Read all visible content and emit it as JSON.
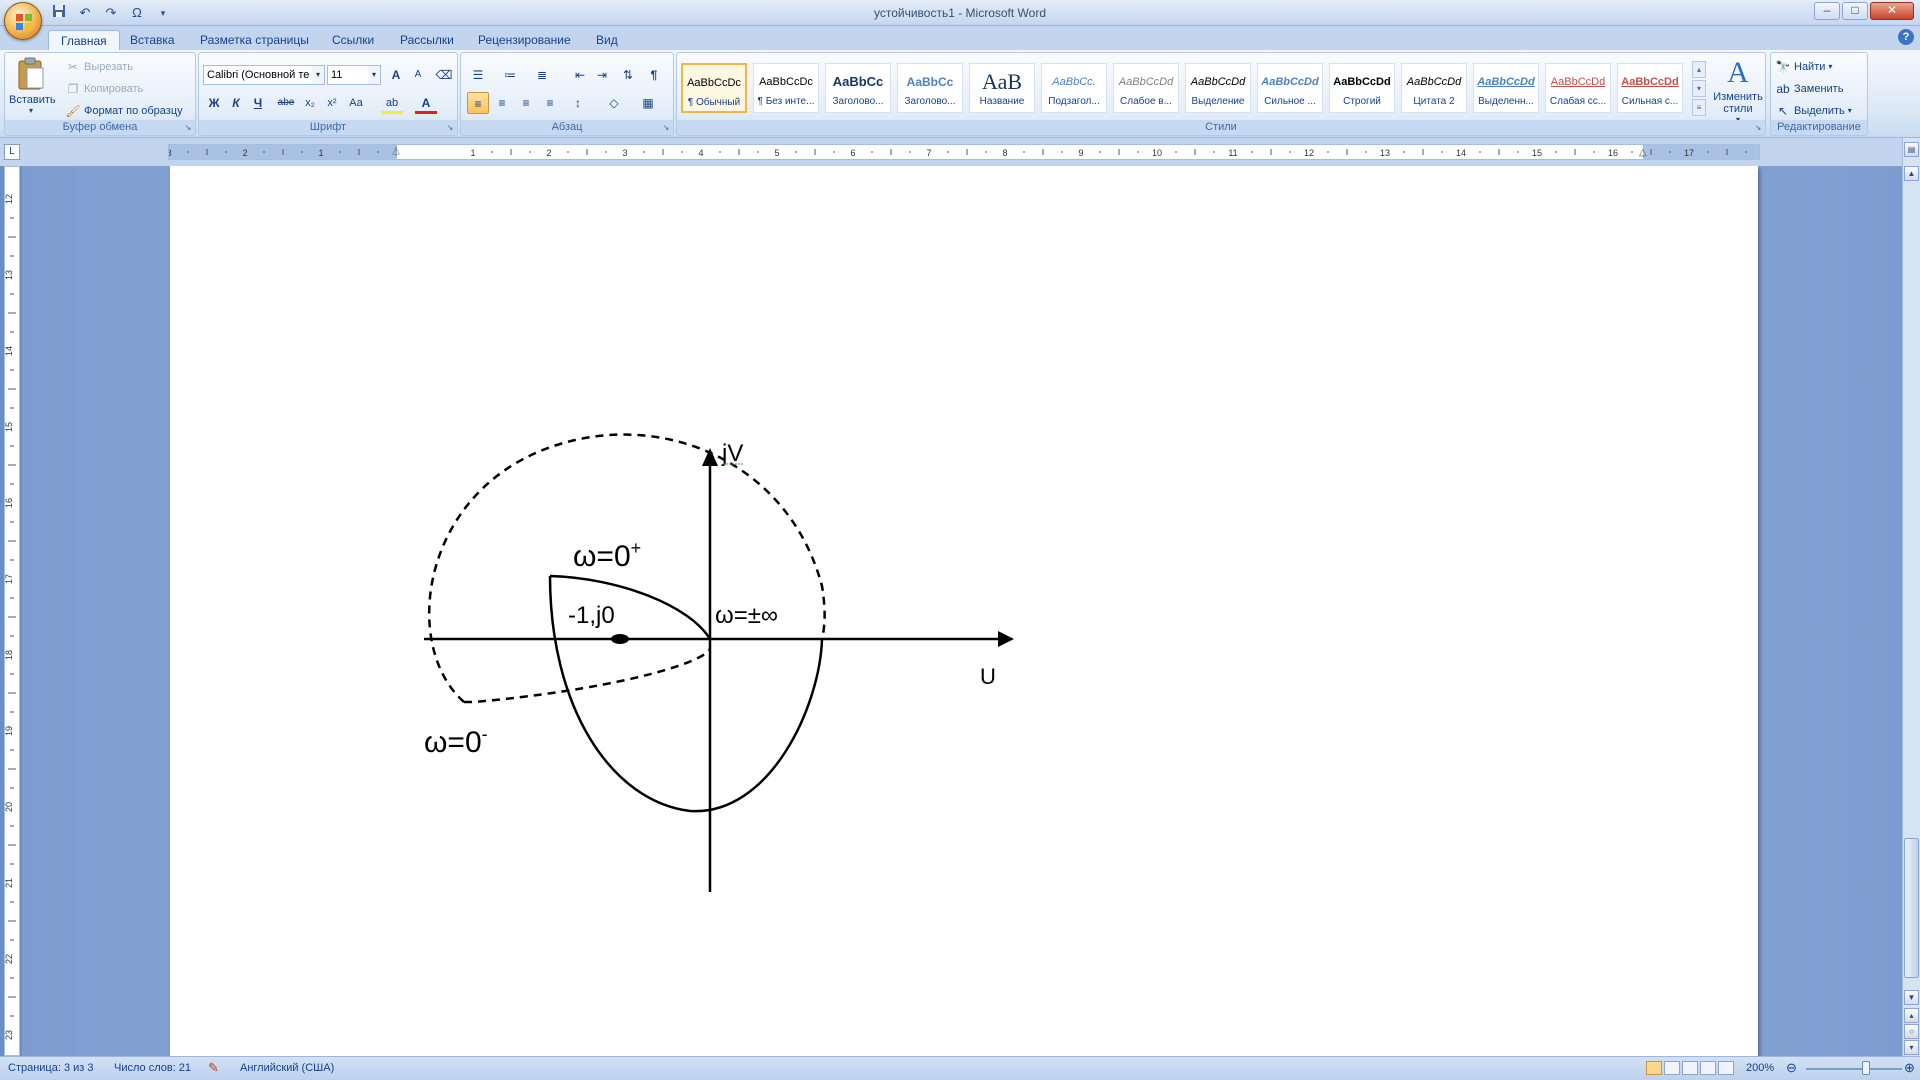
{
  "window": {
    "title": "устойчивость1 - Microsoft Word",
    "minimize": "–",
    "maximize": "□",
    "close": "✕"
  },
  "qat": {
    "save_icon": "save-icon",
    "undo_icon": "undo-icon",
    "redo_icon": "redo-icon",
    "symbol_label": "Ω"
  },
  "tabs": [
    {
      "label": "Главная",
      "active": true
    },
    {
      "label": "Вставка",
      "active": false
    },
    {
      "label": "Разметка страницы",
      "active": false
    },
    {
      "label": "Ссылки",
      "active": false
    },
    {
      "label": "Рассылки",
      "active": false
    },
    {
      "label": "Рецензирование",
      "active": false
    },
    {
      "label": "Вид",
      "active": false
    }
  ],
  "clipboard": {
    "paste_label": "Вставить",
    "cut_label": "Вырезать",
    "copy_label": "Копировать",
    "format_painter_label": "Формат по образцу",
    "group_label": "Буфер обмена"
  },
  "font": {
    "family_value": "Calibri (Основной те",
    "size_value": "11",
    "bold": "Ж",
    "italic": "К",
    "underline": "Ч",
    "strikethrough": "abe",
    "subscript": "x₂",
    "superscript": "x²",
    "change_case": "Aa",
    "grow": "A",
    "shrink": "A",
    "highlight": "ab",
    "font_color": "A",
    "group_label": "Шрифт"
  },
  "paragraph": {
    "group_label": "Абзац",
    "show_marks": "¶"
  },
  "styles": {
    "group_label": "Стили",
    "items": [
      {
        "sample": "AaBbCcDc",
        "name": "¶ Обычный",
        "selected": true
      },
      {
        "sample": "AaBbCcDc",
        "name": "¶ Без инте...",
        "selected": false
      },
      {
        "sample": "AaBbCc",
        "name": "Заголово...",
        "selected": false
      },
      {
        "sample": "AaBbCc",
        "name": "Заголово...",
        "selected": false
      },
      {
        "sample": "АаВ",
        "name": "Название",
        "selected": false
      },
      {
        "sample": "AaBbCc.",
        "name": "Подзагол...",
        "selected": false
      },
      {
        "sample": "AaBbCcDd",
        "name": "Слабое в...",
        "selected": false
      },
      {
        "sample": "AaBbCcDd",
        "name": "Выделение",
        "selected": false
      },
      {
        "sample": "AaBbCcDd",
        "name": "Сильное ...",
        "selected": false
      },
      {
        "sample": "AaBbCcDd",
        "name": "Строгий",
        "selected": false
      },
      {
        "sample": "AaBbCcDd",
        "name": "Цитата 2",
        "selected": false
      },
      {
        "sample": "AaBbCcDd",
        "name": "Выделенн...",
        "selected": false
      },
      {
        "sample": "AaBbCcDd",
        "name": "Слабая сс...",
        "selected": false
      },
      {
        "sample": "AaBbCcDd",
        "name": "Сильная с...",
        "selected": false
      }
    ],
    "change_styles_label": "Изменить стили"
  },
  "editing": {
    "group_label": "Редактирование",
    "find_label": "Найти",
    "replace_label": "Заменить",
    "select_label": "Выделить"
  },
  "ruler": {
    "h_numbers": [
      "3",
      "2",
      "1",
      "1",
      "2",
      "3",
      "4",
      "5",
      "6",
      "7",
      "8",
      "9",
      "10",
      "11",
      "12",
      "13",
      "14",
      "15",
      "16",
      "17"
    ],
    "v_numbers": [
      "12",
      "13",
      "14",
      "15",
      "16",
      "17",
      "18",
      "19",
      "20",
      "21",
      "22",
      "23"
    ],
    "corner_label": "L"
  },
  "figure": {
    "axis_y_label": "jV",
    "axis_x_label": "U",
    "omega_plus_base": "ω=0",
    "omega_plus_sup": "+",
    "omega_minus_base": "ω=0",
    "omega_minus_sup": "-",
    "point_label": "-1,j0",
    "omega_inf_label": "ω=±∞"
  },
  "status": {
    "page": "Страница: 3 из 3",
    "words": "Число слов: 21",
    "language": "Английский (США)",
    "zoom": "200%",
    "zoom_level_percent": 200
  },
  "colors": {
    "ribbon_text": "#15428b",
    "style_selected": "#f0b64b"
  }
}
